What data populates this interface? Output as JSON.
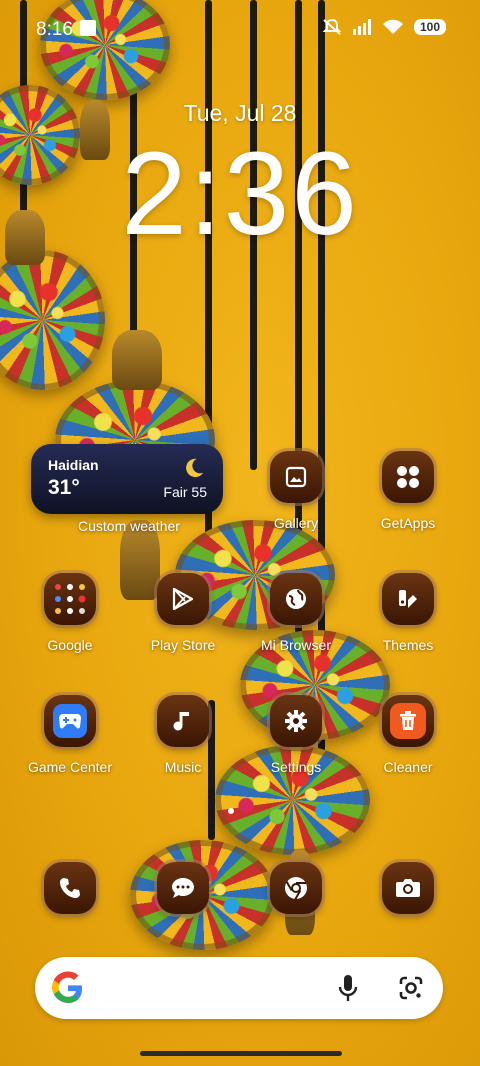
{
  "status_bar": {
    "time": "8:16",
    "battery": "100",
    "icons": [
      "mute-icon",
      "signal-icon",
      "wifi-icon",
      "battery-icon"
    ]
  },
  "lockclock": {
    "date": "Tue, Jul 28",
    "time": "2:36"
  },
  "weather_widget": {
    "city": "Haidian",
    "temperature": "31°",
    "condition": "Fair 55",
    "label": "Custom weather"
  },
  "apps": {
    "gallery": "Gallery",
    "getapps": "GetApps",
    "google": "Google",
    "play_store": "Play Store",
    "mi_browser": "Mi Browser",
    "themes": "Themes",
    "game_center": "Game Center",
    "music": "Music",
    "settings": "Settings",
    "cleaner": "Cleaner"
  },
  "dock": [
    "phone-icon",
    "messages-icon",
    "chrome-icon",
    "camera-icon"
  ],
  "colors": {
    "wallpaper": "#e8a70e",
    "icon_bg": "#4a1f08",
    "weather_bg": "#1a1f3d",
    "cleaner_accent": "#f05a1e"
  }
}
